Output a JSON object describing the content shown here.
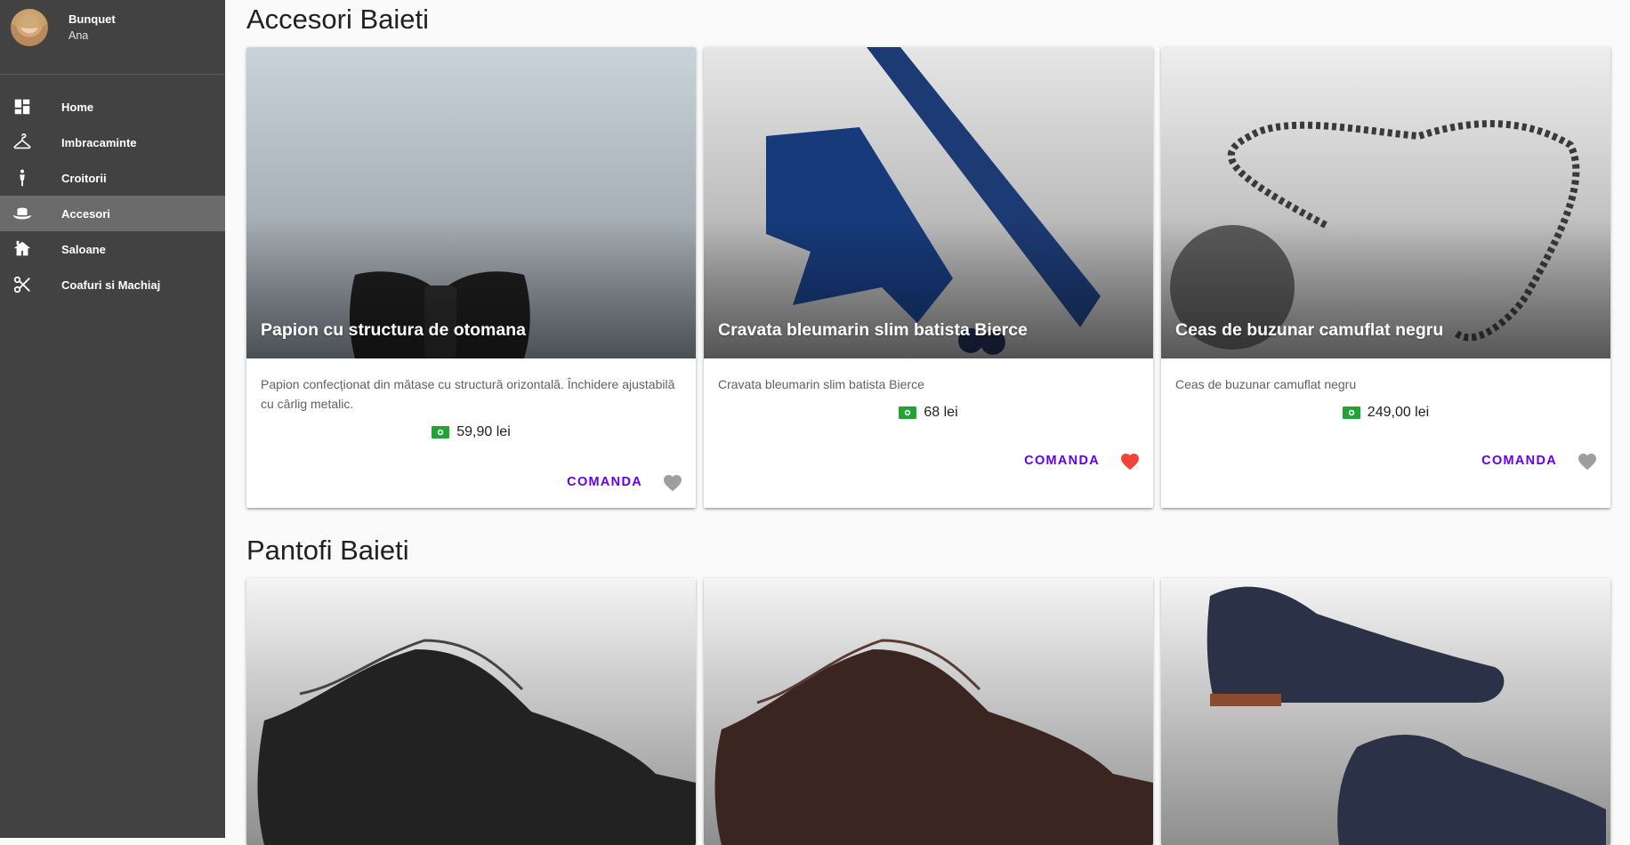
{
  "sidebar": {
    "user": {
      "name": "Bunquet",
      "subtitle": "Ana"
    },
    "items": [
      {
        "label": "Home",
        "icon": "dashboard-icon",
        "active": false
      },
      {
        "label": "Imbracaminte",
        "icon": "hanger-icon",
        "active": false
      },
      {
        "label": "Croitorii",
        "icon": "person-icon",
        "active": false
      },
      {
        "label": "Accesori",
        "icon": "hat-icon",
        "active": true
      },
      {
        "label": "Saloane",
        "icon": "house-icon",
        "active": false
      },
      {
        "label": "Coafuri si Machiaj",
        "icon": "scissors-icon",
        "active": false
      }
    ]
  },
  "sections": [
    {
      "title": "Accesori Baieti",
      "cards": [
        {
          "title": "Papion cu structura de otomana",
          "description": "Papion confecționat din mătase cu structură orizontală. Închidere ajustabilă cu cârlig metalic.",
          "price": "59,90 lei",
          "action": "COMANDA",
          "favorite": false
        },
        {
          "title": "Cravata bleumarin slim batista Bierce",
          "description": "Cravata bleumarin slim batista Bierce",
          "price": "68 lei",
          "action": "COMANDA",
          "favorite": true
        },
        {
          "title": "Ceas de buzunar camuflat negru",
          "description": "Ceas de buzunar camuflat negru",
          "price": "249,00 lei",
          "action": "COMANDA",
          "favorite": false
        }
      ]
    },
    {
      "title": "Pantofi Baieti"
    }
  ],
  "colors": {
    "accent": "#6200ee",
    "favorite": "#f44336",
    "heart_off": "#9e9e9e",
    "money": "#21a336",
    "sidebar": "#424242"
  }
}
